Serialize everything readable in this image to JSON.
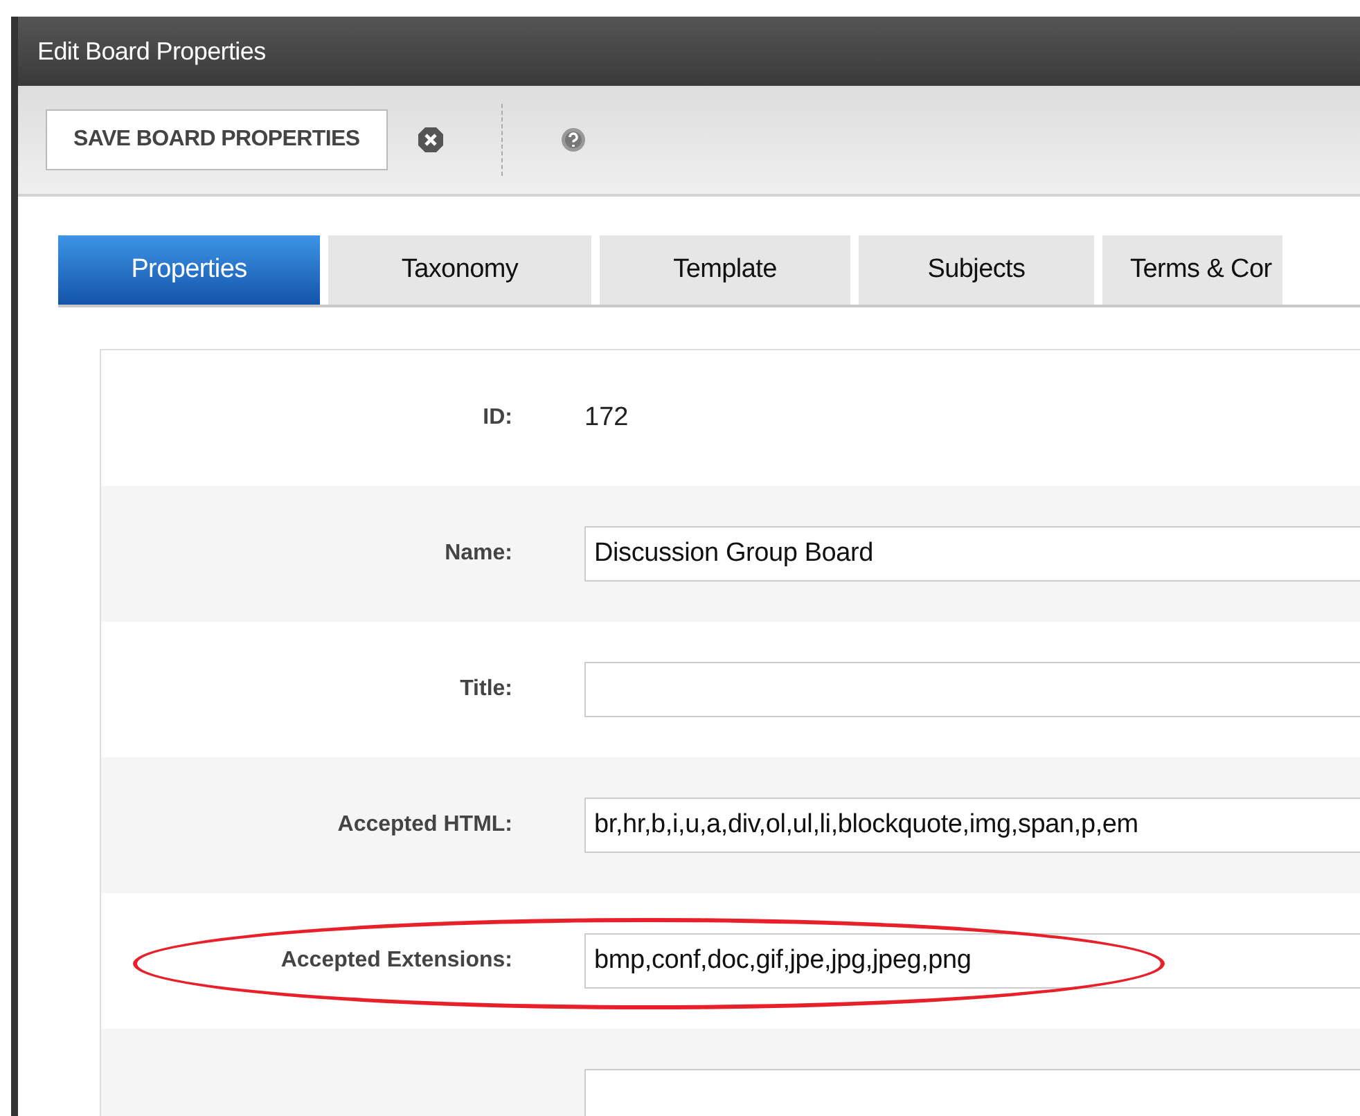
{
  "window": {
    "title": "Edit Board Properties"
  },
  "toolbar": {
    "save_button": "SAVE BOARD PROPERTIES"
  },
  "tabs": [
    {
      "label": "Properties",
      "selected": true
    },
    {
      "label": "Taxonomy",
      "selected": false
    },
    {
      "label": "Template",
      "selected": false
    },
    {
      "label": "Subjects",
      "selected": false
    },
    {
      "label": "Terms & Cor",
      "selected": false
    }
  ],
  "form": {
    "rows": [
      {
        "kind": "text",
        "label": "ID:",
        "value": "172",
        "highlighted": false
      },
      {
        "kind": "input",
        "label": "Name:",
        "value": "Discussion Group Board",
        "highlighted": false
      },
      {
        "kind": "input",
        "label": "Title:",
        "highlighted": false
      },
      {
        "kind": "input",
        "label": "Accepted HTML:",
        "value": "br,hr,b,i,u,a,div,ol,ul,li,blockquote,img,span,p,em",
        "highlighted": false
      },
      {
        "kind": "input",
        "label": "Accepted Extensions:",
        "value": "bmp,conf,doc,gif,jpe,jpg,jpeg,png",
        "highlighted": true
      },
      {
        "kind": "input",
        "highlighted": false
      }
    ]
  }
}
